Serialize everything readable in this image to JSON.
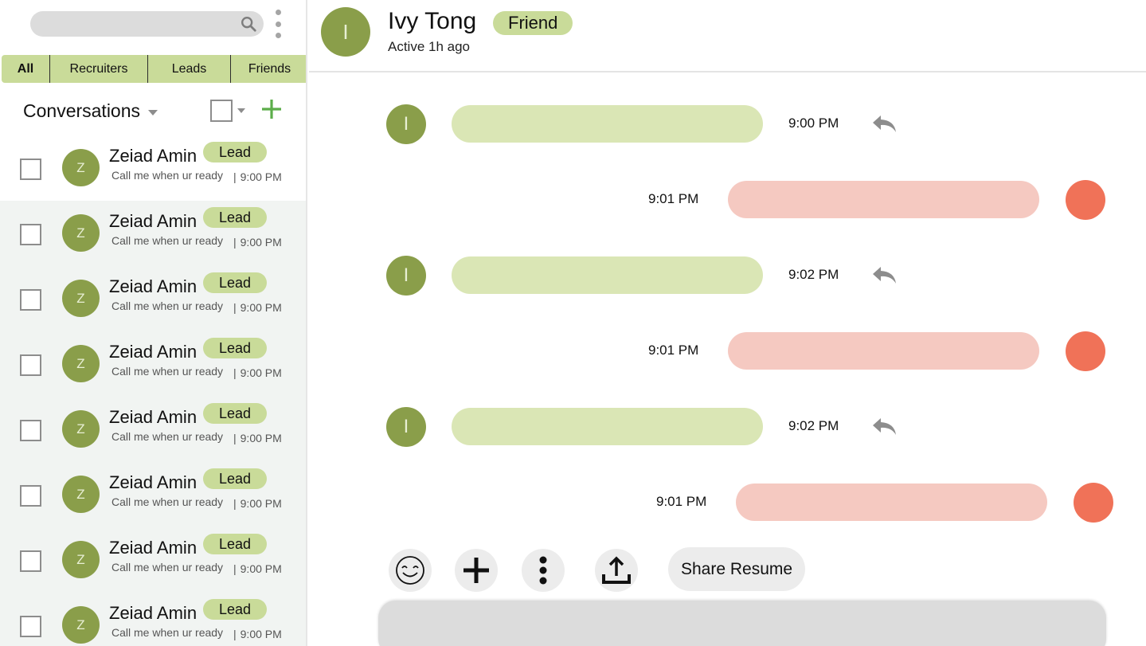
{
  "sidebar": {
    "search": {
      "placeholder": "",
      "icon": "search-icon"
    },
    "filters": [
      {
        "label": "All",
        "active": true
      },
      {
        "label": "Recruiters",
        "active": false
      },
      {
        "label": "Leads",
        "active": false
      },
      {
        "label": "Friends",
        "active": false
      }
    ],
    "conversations_label": "Conversations",
    "items": [
      {
        "initial": "Z",
        "name": "Zeiad Amin",
        "tag": "Lead",
        "preview": "Call me when ur ready",
        "time": "9:00 PM",
        "selected": true
      },
      {
        "initial": "Z",
        "name": "Zeiad Amin",
        "tag": "Lead",
        "preview": "Call me when ur ready",
        "time": "9:00 PM",
        "selected": false
      },
      {
        "initial": "Z",
        "name": "Zeiad Amin",
        "tag": "Lead",
        "preview": "Call me when ur ready",
        "time": "9:00 PM",
        "selected": false
      },
      {
        "initial": "Z",
        "name": "Zeiad Amin",
        "tag": "Lead",
        "preview": "Call me when ur ready",
        "time": "9:00 PM",
        "selected": false
      },
      {
        "initial": "Z",
        "name": "Zeiad Amin",
        "tag": "Lead",
        "preview": "Call me when ur ready",
        "time": "9:00 PM",
        "selected": false
      },
      {
        "initial": "Z",
        "name": "Zeiad Amin",
        "tag": "Lead",
        "preview": "Call me when ur ready",
        "time": "9:00 PM",
        "selected": false
      },
      {
        "initial": "Z",
        "name": "Zeiad Amin",
        "tag": "Lead",
        "preview": "Call me when ur ready",
        "time": "9:00 PM",
        "selected": false
      },
      {
        "initial": "Z",
        "name": "Zeiad Amin",
        "tag": "Lead",
        "preview": "Call me when ur ready",
        "time": "9:00 PM",
        "selected": false
      }
    ]
  },
  "chat": {
    "contact": {
      "initial": "I",
      "name": "Ivy Tong",
      "tag": "Friend",
      "status": "Active 1h ago"
    },
    "messages": [
      {
        "direction": "in",
        "initial": "I",
        "time": "9:00 PM"
      },
      {
        "direction": "out",
        "time": "9:01 PM"
      },
      {
        "direction": "in",
        "initial": "I",
        "time": "9:02 PM"
      },
      {
        "direction": "out",
        "time": "9:01 PM"
      },
      {
        "direction": "in",
        "initial": "I",
        "time": "9:02 PM"
      },
      {
        "direction": "out",
        "time": "9:01 PM"
      }
    ],
    "toolbar": {
      "buttons": [
        "emoji-icon",
        "plus-icon",
        "more-vertical-icon",
        "upload-icon"
      ],
      "share_label": "Share Resume"
    },
    "composer": {
      "placeholder": ""
    }
  },
  "colors": {
    "accent_green": "#8a9e4a",
    "tag_green": "#c9db99",
    "bubble_in": "#dae6b5",
    "bubble_out": "#f5c9c1",
    "avatar_out": "#f07258",
    "add_icon": "#5cad4a"
  }
}
